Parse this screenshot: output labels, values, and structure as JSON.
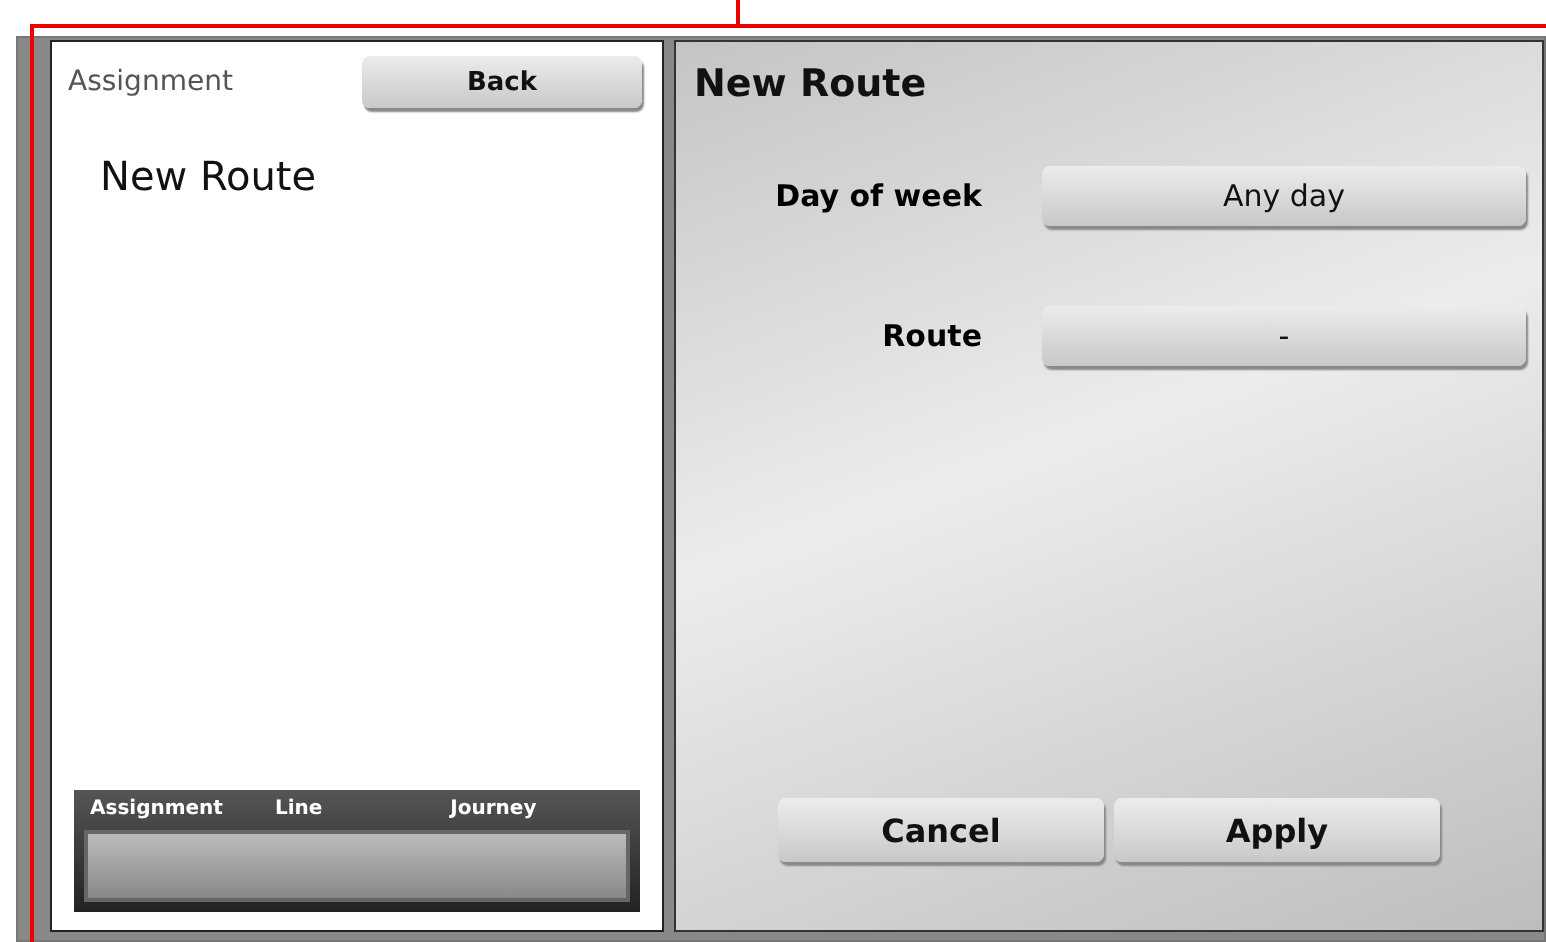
{
  "left_panel": {
    "title": "Assignment",
    "back_button": "Back",
    "heading": "New Route",
    "footer": {
      "columns": [
        "Assignment",
        "Line",
        "Journey"
      ]
    }
  },
  "right_panel": {
    "title": "New Route",
    "fields": [
      {
        "label": "Day of week",
        "value": "Any day"
      },
      {
        "label": "Route",
        "value": "-"
      }
    ],
    "buttons": [
      "Cancel",
      "Apply"
    ]
  }
}
